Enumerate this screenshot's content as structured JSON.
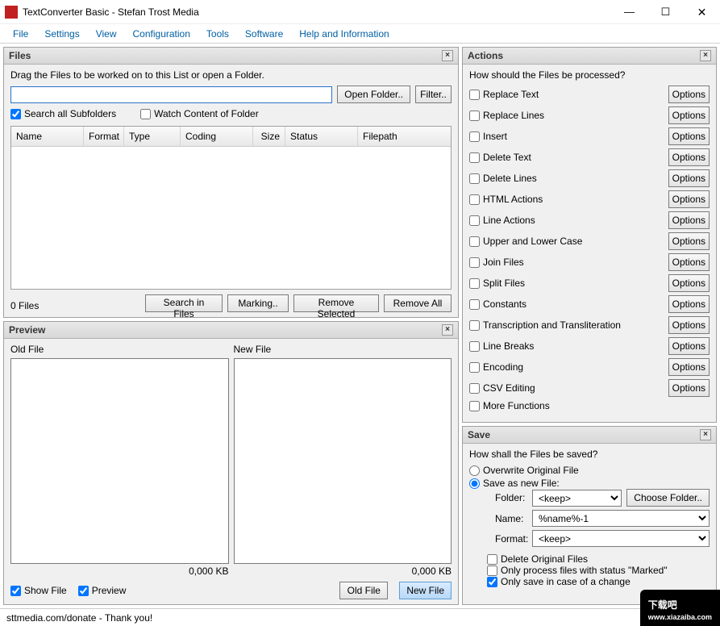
{
  "window": {
    "title": "TextConverter Basic - Stefan Trost Media"
  },
  "menu": [
    "File",
    "Settings",
    "View",
    "Configuration",
    "Tools",
    "Software",
    "Help and Information"
  ],
  "files": {
    "title": "Files",
    "instruction": "Drag the Files to be worked on to this List or open a Folder.",
    "openFolder": "Open Folder..",
    "filter": "Filter..",
    "searchSubfolders": "Search all Subfolders",
    "watchFolder": "Watch Content of Folder",
    "cols": {
      "name": "Name",
      "format": "Format",
      "type": "Type",
      "coding": "Coding",
      "size": "Size",
      "status": "Status",
      "filepath": "Filepath"
    },
    "count": "0 Files",
    "btns": {
      "searchInFiles": "Search in Files",
      "marking": "Marking..",
      "removeSelected": "Remove Selected",
      "removeAll": "Remove All"
    }
  },
  "preview": {
    "title": "Preview",
    "oldFile": "Old File",
    "newFile": "New File",
    "size": "0,000 KB",
    "showFile": "Show File",
    "previewChk": "Preview",
    "oldBtn": "Old File",
    "newBtn": "New File"
  },
  "actions": {
    "title": "Actions",
    "instruction": "How should the Files be processed?",
    "optionsBtn": "Options",
    "items": [
      "Replace Text",
      "Replace Lines",
      "Insert",
      "Delete Text",
      "Delete Lines",
      "HTML Actions",
      "Line Actions",
      "Upper and Lower Case",
      "Join Files",
      "Split Files",
      "Constants",
      "Transcription and Transliteration",
      "Line Breaks",
      "Encoding",
      "CSV Editing"
    ],
    "moreFunctions": "More Functions"
  },
  "save": {
    "title": "Save",
    "instruction": "How shall the Files be saved?",
    "overwrite": "Overwrite Original File",
    "saveNew": "Save as new File:",
    "folderLabel": "Folder:",
    "folderValue": "<keep>",
    "chooseFolder": "Choose Folder..",
    "nameLabel": "Name:",
    "nameValue": "%name%-1",
    "formatLabel": "Format:",
    "formatValue": "<keep>",
    "deleteOriginal": "Delete Original Files",
    "onlyMarked": "Only process files with status \"Marked\"",
    "onlySaveChange": "Only save in case of a change"
  },
  "status": "sttmedia.com/donate - Thank you!",
  "watermark": {
    "big": "下载吧",
    "small": "www.xiazaiba.com"
  }
}
